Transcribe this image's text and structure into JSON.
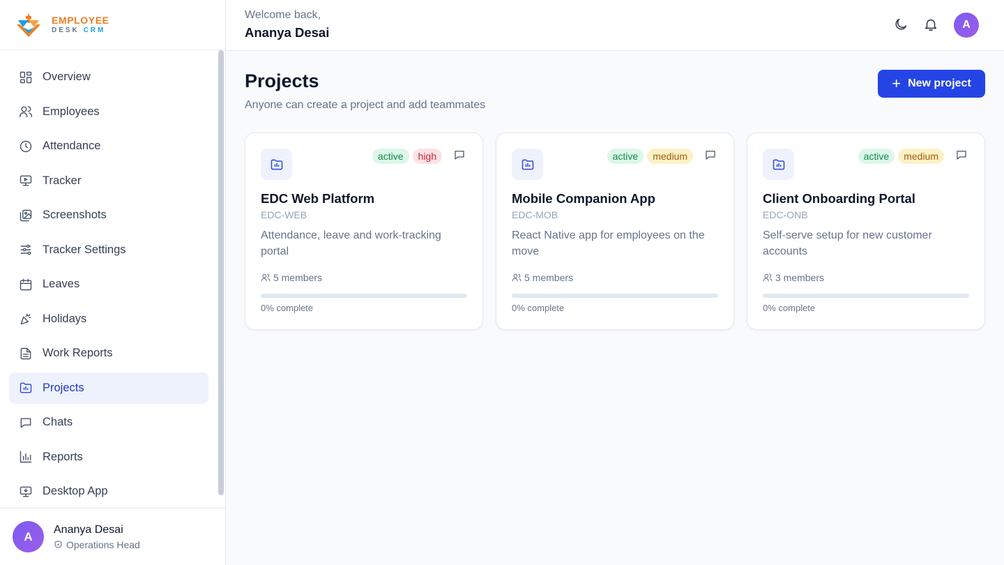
{
  "brand": {
    "name_top": "EMPLOYEE",
    "name_bottom": "DESK",
    "name_accent": "CRM"
  },
  "sidebar": {
    "items": [
      {
        "label": "Overview",
        "icon": "overview-icon"
      },
      {
        "label": "Employees",
        "icon": "users-icon"
      },
      {
        "label": "Attendance",
        "icon": "clock-icon"
      },
      {
        "label": "Tracker",
        "icon": "monitor-icon"
      },
      {
        "label": "Screenshots",
        "icon": "images-icon"
      },
      {
        "label": "Tracker Settings",
        "icon": "sliders-icon"
      },
      {
        "label": "Leaves",
        "icon": "calendar-icon"
      },
      {
        "label": "Holidays",
        "icon": "party-icon"
      },
      {
        "label": "Work Reports",
        "icon": "document-icon"
      },
      {
        "label": "Projects",
        "icon": "folder-chart-icon",
        "active": true
      },
      {
        "label": "Chats",
        "icon": "chat-icon"
      },
      {
        "label": "Reports",
        "icon": "bar-chart-icon"
      },
      {
        "label": "Desktop App",
        "icon": "desktop-download-icon"
      }
    ]
  },
  "user": {
    "initial": "A",
    "name": "Ananya Desai",
    "role": "Operations Head"
  },
  "header": {
    "welcome": "Welcome back,",
    "name": "Ananya Desai",
    "avatar_initial": "A",
    "icons": [
      "moon-icon",
      "bell-icon"
    ]
  },
  "page": {
    "title": "Projects",
    "subtitle": "Anyone can create a project and add teammates",
    "new_button": "New project"
  },
  "projects": [
    {
      "name": "EDC Web Platform",
      "code": "EDC-WEB",
      "description": "Attendance, leave and work-tracking portal",
      "status": "active",
      "priority": "high",
      "members": "5 members",
      "progress": 0,
      "progress_label": "0% complete"
    },
    {
      "name": "Mobile Companion App",
      "code": "EDC-MOB",
      "description": "React Native app for employees on the move",
      "status": "active",
      "priority": "medium",
      "members": "5 members",
      "progress": 0,
      "progress_label": "0% complete"
    },
    {
      "name": "Client Onboarding Portal",
      "code": "EDC-ONB",
      "description": "Self-serve setup for new customer accounts",
      "status": "active",
      "priority": "medium",
      "members": "3 members",
      "progress": 0,
      "progress_label": "0% complete"
    }
  ],
  "colors": {
    "accent": "#2544e6",
    "active_bg": "#eef2fd",
    "status_active": "#0f8a4f",
    "priority_high": "#c8243a",
    "priority_medium": "#a15c07"
  }
}
